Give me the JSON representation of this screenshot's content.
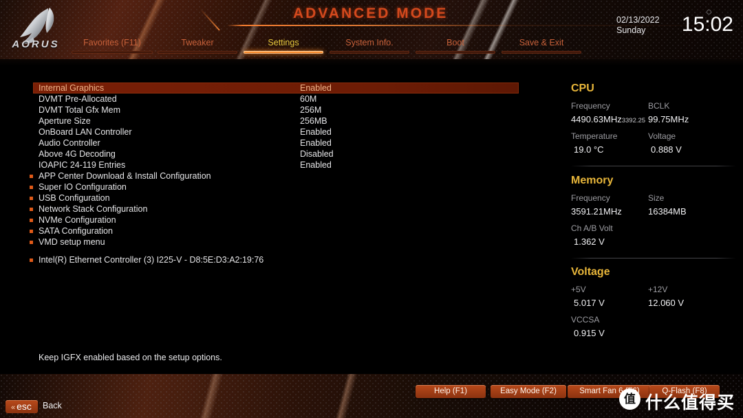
{
  "header": {
    "logo_word": "AORUS",
    "mode_title": "ADVANCED MODE",
    "date": "02/13/2022",
    "weekday": "Sunday",
    "time": "15:02"
  },
  "nav": {
    "tabs": [
      {
        "label": "Favorites (F11)",
        "active": false
      },
      {
        "label": "Tweaker",
        "active": false
      },
      {
        "label": "Settings",
        "active": true
      },
      {
        "label": "System Info.",
        "active": false
      },
      {
        "label": "Boot",
        "active": false
      },
      {
        "label": "Save & Exit",
        "active": false
      }
    ]
  },
  "settings": {
    "rows": [
      {
        "label": "Internal Graphics",
        "value": "Enabled",
        "selected": true
      },
      {
        "label": "DVMT Pre-Allocated",
        "value": "60M",
        "selected": false
      },
      {
        "label": "DVMT Total Gfx Mem",
        "value": "256M",
        "selected": false
      },
      {
        "label": "Aperture Size",
        "value": "256MB",
        "selected": false
      },
      {
        "label": "OnBoard LAN Controller",
        "value": "Enabled",
        "selected": false
      },
      {
        "label": "Audio Controller",
        "value": "Enabled",
        "selected": false
      },
      {
        "label": "Above 4G Decoding",
        "value": "Disabled",
        "selected": false
      },
      {
        "label": "IOAPIC 24-119 Entries",
        "value": "Enabled",
        "selected": false
      }
    ],
    "submenus": [
      {
        "label": "APP Center Download & Install Configuration"
      },
      {
        "label": "Super IO Configuration"
      },
      {
        "label": "USB Configuration"
      },
      {
        "label": "Network Stack Configuration"
      },
      {
        "label": "NVMe Configuration"
      },
      {
        "label": "SATA Configuration"
      },
      {
        "label": "VMD setup menu"
      }
    ],
    "devices": [
      {
        "label": "Intel(R) Ethernet Controller (3) I225-V - D8:5E:D3:A2:19:76"
      }
    ]
  },
  "sidebar": {
    "cpu": {
      "title": "CPU",
      "frequency_label": "Frequency",
      "frequency_value": "4490.63MHz",
      "frequency_sub": "3392.25",
      "bclk_label": "BCLK",
      "bclk_value": "99.75MHz",
      "temperature_label": "Temperature",
      "temperature_value": "19.0 °C",
      "voltage_label": "Voltage",
      "voltage_value": "0.888 V"
    },
    "memory": {
      "title": "Memory",
      "frequency_label": "Frequency",
      "frequency_value": "3591.21MHz",
      "size_label": "Size",
      "size_value": "16384MB",
      "chab_label": "Ch A/B Volt",
      "chab_value": "1.362 V"
    },
    "voltage": {
      "title": "Voltage",
      "v5_label": "+5V",
      "v5_value": "5.017 V",
      "v12_label": "+12V",
      "v12_value": "12.060 V",
      "vccsa_label": "VCCSA",
      "vccsa_value": "0.915 V"
    }
  },
  "help": {
    "text": "Keep IGFX enabled based on the setup options."
  },
  "footer": {
    "buttons": [
      {
        "label": "Help (F1)"
      },
      {
        "label": "Easy Mode (F2)"
      },
      {
        "label": "Smart Fan 6 (F6)"
      },
      {
        "label": "Q-Flash (F8)"
      }
    ],
    "esc_key": "esc",
    "esc_chevron": "«",
    "back_label": "Back"
  },
  "watermark": {
    "mark": "值",
    "text": "什么值得买"
  },
  "colors": {
    "accent_orange": "#d4491d",
    "accent_gold": "#e8b63a",
    "highlight_row": "#7a1f06",
    "tab_inactive": "#c8613a",
    "tab_active": "#e8c93c",
    "bullet": "#e05a18"
  }
}
